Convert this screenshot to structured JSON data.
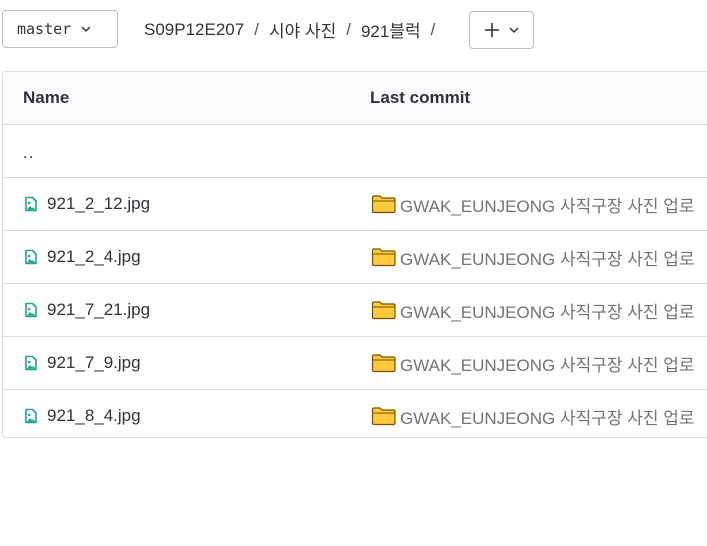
{
  "branch": {
    "name": "master",
    "icon": "chevron-down-icon"
  },
  "breadcrumb": {
    "items": [
      "S09P12E207",
      "시야 사진",
      "921블럭"
    ],
    "separator": "/"
  },
  "add_button": {
    "icon": "plus-icon",
    "dropdown_icon": "chevron-down-icon"
  },
  "table": {
    "headers": {
      "name": "Name",
      "last_commit": "Last commit"
    },
    "parent_dir": "..",
    "rows": [
      {
        "name": "921_2_12.jpg",
        "commit": "GWAK_EUNJEONG 사직구장 사진 업로"
      },
      {
        "name": "921_2_4.jpg",
        "commit": "GWAK_EUNJEONG 사직구장 사진 업로"
      },
      {
        "name": "921_7_21.jpg",
        "commit": "GWAK_EUNJEONG 사직구장 사진 업로"
      },
      {
        "name": "921_7_9.jpg",
        "commit": "GWAK_EUNJEONG 사직구장 사진 업로"
      },
      {
        "name": "921_8_4.jpg",
        "commit": "GWAK_EUNJEONG 사직구장 사진 업로"
      }
    ],
    "file_icon": "image-file-icon",
    "commit_icon": "folder-emoji-icon"
  },
  "colors": {
    "file_icon": "#1aaa8b",
    "folder_fill": "#ffc83d",
    "folder_stroke": "#7a5300",
    "border": "#dcdcde",
    "header_bg": "#fbfafd"
  }
}
